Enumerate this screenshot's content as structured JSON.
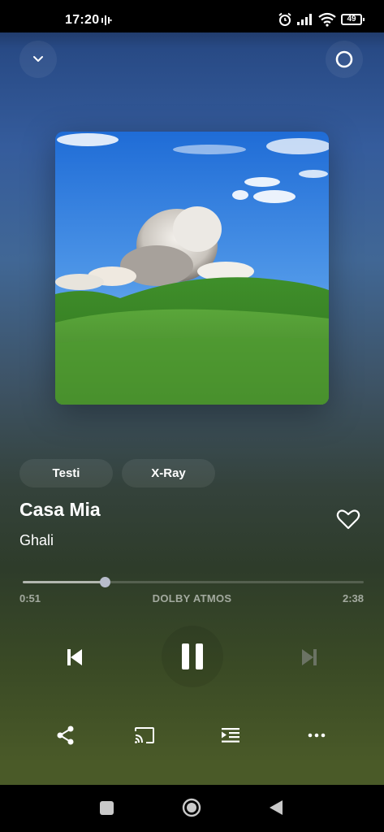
{
  "status_bar": {
    "time": "17:20",
    "battery": "49",
    "icons": [
      "recording-icon",
      "alarm-icon",
      "signal-icon",
      "wifi-icon",
      "battery-icon"
    ]
  },
  "header": {
    "collapse_icon": "chevron-down-icon",
    "alexa_icon": "alexa-ring-icon"
  },
  "album_art": {
    "description_icon": "album-art-image"
  },
  "chips": {
    "lyrics": "Testi",
    "xray": "X-Ray"
  },
  "track": {
    "title": "Casa Mia",
    "artist": "Ghali"
  },
  "playback": {
    "elapsed": "0:51",
    "total": "2:38",
    "format": "DOLBY ATMOS",
    "progress_fraction": 0.24,
    "state": "playing"
  },
  "controls": {
    "prev_icon": "skip-previous-icon",
    "pause_icon": "pause-icon",
    "next_icon": "skip-next-icon",
    "share_icon": "share-icon",
    "cast_icon": "cast-icon",
    "queue_icon": "queue-icon",
    "more_icon": "more-horizontal-icon"
  },
  "colors": {
    "accent": "#ffffff",
    "knob": "#b7bccb",
    "next_disabled": "#6b7364"
  }
}
